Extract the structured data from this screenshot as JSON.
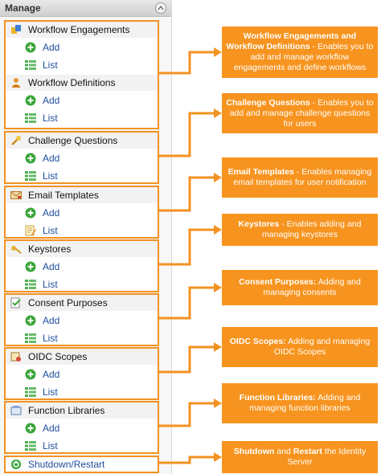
{
  "panel": {
    "title": "Manage"
  },
  "groups": [
    {
      "items": [
        {
          "type": "heading",
          "label": "Workflow Engagements",
          "icon": "workflow-engagements-icon"
        },
        {
          "type": "action",
          "label": "Add",
          "icon": "add-icon"
        },
        {
          "type": "action",
          "label": "List",
          "icon": "list-icon"
        },
        {
          "type": "heading",
          "label": "Workflow Definitions",
          "icon": "workflow-definitions-icon"
        },
        {
          "type": "action",
          "label": "Add",
          "icon": "add-icon"
        },
        {
          "type": "action",
          "label": "List",
          "icon": "list-icon"
        }
      ]
    },
    {
      "items": [
        {
          "type": "heading",
          "label": "Challenge Questions",
          "icon": "challenge-questions-icon"
        },
        {
          "type": "action",
          "label": "Add",
          "icon": "add-icon"
        },
        {
          "type": "action",
          "label": "List",
          "icon": "list-icon"
        }
      ]
    },
    {
      "items": [
        {
          "type": "heading",
          "label": "Email Templates",
          "icon": "email-templates-icon"
        },
        {
          "type": "action",
          "label": "Add",
          "icon": "add-icon"
        },
        {
          "type": "action",
          "label": "List",
          "icon": "edit-list-icon"
        }
      ]
    },
    {
      "items": [
        {
          "type": "heading",
          "label": "Keystores",
          "icon": "key-icon"
        },
        {
          "type": "action",
          "label": "Add",
          "icon": "add-icon"
        },
        {
          "type": "action",
          "label": "List",
          "icon": "list-icon"
        }
      ]
    },
    {
      "items": [
        {
          "type": "heading",
          "label": "Consent Purposes",
          "icon": "consent-purposes-icon"
        },
        {
          "type": "action",
          "label": "Add",
          "icon": "add-icon"
        },
        {
          "type": "action",
          "label": "List",
          "icon": "list-icon"
        }
      ]
    },
    {
      "items": [
        {
          "type": "heading",
          "label": "OIDC Scopes",
          "icon": "oidc-scopes-icon"
        },
        {
          "type": "action",
          "label": "Add",
          "icon": "add-icon"
        },
        {
          "type": "action",
          "label": "List",
          "icon": "list-icon"
        }
      ]
    },
    {
      "items": [
        {
          "type": "heading",
          "label": "Function Libraries",
          "icon": "function-libraries-icon"
        },
        {
          "type": "action",
          "label": "Add",
          "icon": "add-icon"
        },
        {
          "type": "action",
          "label": "List",
          "icon": "list-icon"
        }
      ]
    },
    {
      "items": [
        {
          "type": "action",
          "label": "Shutdown/Restart",
          "icon": "shutdown-restart-icon"
        }
      ]
    }
  ],
  "callouts": [
    {
      "bold": "Workflow Engagements and Workflow Definitions",
      "text": " - Enables you to add and manage workflow engagements and define workflows"
    },
    {
      "bold": "Challenge Questions",
      "text": " -  Enables you to add and manage challenge questions for users"
    },
    {
      "bold": "Email Templates",
      "text": " - Enables managing email templates for user notification"
    },
    {
      "bold": "Keystores",
      "text": " -  Enables adding and managing keystores"
    },
    {
      "bold": "Consent Purposes:",
      "text": "  Adding and managing consents"
    },
    {
      "bold": "OIDC Scopes:",
      "text": " Adding and managing OIDC Scopes"
    },
    {
      "bold": "Function Libraries:",
      "text": " Adding and managing function libraries"
    },
    {
      "bold": "Shutdown",
      "text": " and ",
      "bold2": "Restart",
      "text2": " the Identity Server"
    }
  ],
  "colors": {
    "accent": "#f39222",
    "callout_bg": "#f7941f",
    "link": "#1f4e9c",
    "add_icon": "#3aa53a"
  }
}
